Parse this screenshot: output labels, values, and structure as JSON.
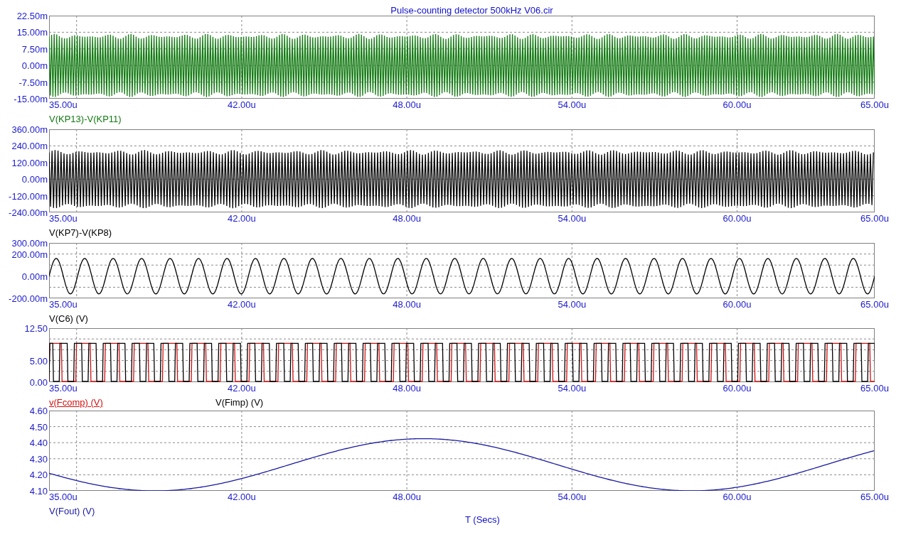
{
  "title": "Pulse-counting detector 500kHz V06.cir",
  "panels": [
    {
      "y_ticks": [
        "22.50m",
        "15.00m",
        "7.50m",
        "0.00m",
        "-7.50m",
        "-15.00m"
      ],
      "x_ticks": [
        "35.00u",
        "42.00u",
        "48.00u",
        "54.00u",
        "60.00u",
        "65.00u"
      ],
      "traces": [
        {
          "label": "V(KP13)-V(KP11)",
          "color": "#127a12",
          "kind": "dense",
          "selected": false
        }
      ]
    },
    {
      "y_ticks": [
        "360.00m",
        "240.00m",
        "120.00m",
        "0.00m",
        "-120.00m",
        "-240.00m"
      ],
      "x_ticks": [
        "35.00u",
        "42.00u",
        "48.00u",
        "54.00u",
        "60.00u",
        "65.00u"
      ],
      "traces": [
        {
          "label": "V(KP7)-V(KP8)",
          "color": "#000000",
          "kind": "dense",
          "selected": false
        }
      ]
    },
    {
      "y_ticks": [
        "300.00m",
        "200.00m",
        "0.00m",
        "-200.00m"
      ],
      "x_ticks": [
        "35.00u",
        "42.00u",
        "48.00u",
        "54.00u",
        "60.00u",
        "65.00u"
      ],
      "traces": [
        {
          "label": "V(C6) (V)",
          "color": "#000000",
          "kind": "sine",
          "selected": false
        }
      ]
    },
    {
      "y_ticks": [
        "12.50",
        "5.00",
        "0.00"
      ],
      "x_ticks": [
        "35.00u",
        "42.00u",
        "48.00u",
        "54.00u",
        "60.00u",
        "65.00u"
      ],
      "traces": [
        {
          "label": "v(Fcomp) (V)",
          "color": "#d01010",
          "kind": "square",
          "selected": true
        },
        {
          "label": "V(Fimp) (V)",
          "color": "#000000",
          "kind": "square",
          "selected": false
        }
      ]
    },
    {
      "y_ticks": [
        "4.60",
        "4.50",
        "4.40",
        "4.30",
        "4.20",
        "4.10"
      ],
      "x_ticks": [
        "35.00u",
        "42.00u",
        "48.00u",
        "54.00u",
        "60.00u",
        "65.00u"
      ],
      "traces": [
        {
          "label": "V(Fout) (V)",
          "color": "#1a1aa0",
          "kind": "slow-sine",
          "selected": false
        }
      ]
    }
  ],
  "x_axis_label": "T (Secs)"
}
